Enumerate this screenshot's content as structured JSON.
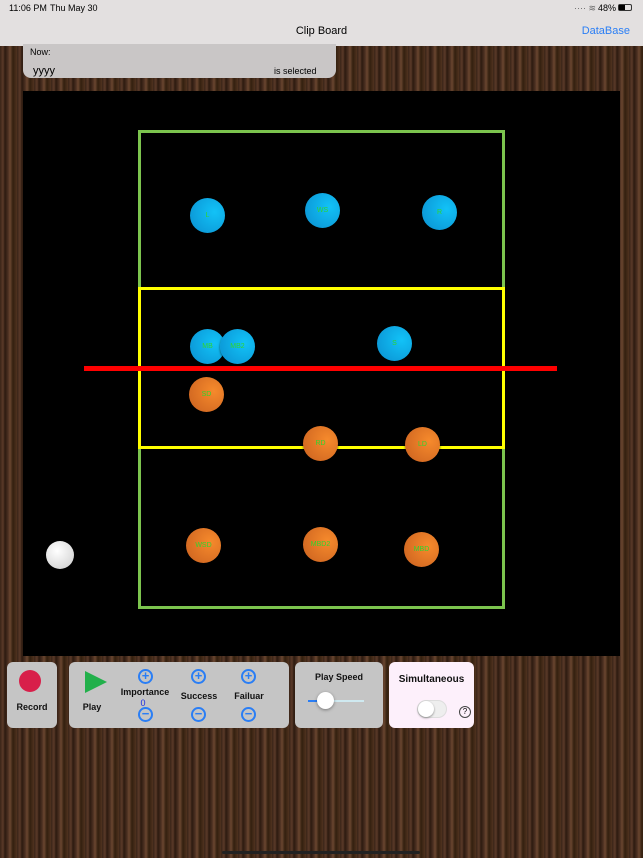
{
  "status_bar": {
    "time": "11:06 PM",
    "date": "Thu May 30",
    "battery": "48%"
  },
  "header": {
    "title": "Clip Board",
    "database_link": "DataBase"
  },
  "now_box": {
    "label": "Now:",
    "value": "yyyy",
    "suffix": "is selected"
  },
  "players": {
    "blue": [
      "L",
      "WS",
      "R",
      "MB",
      "MB2",
      "S"
    ],
    "orange": [
      "SD",
      "RD",
      "LD",
      "WSD",
      "MBD2",
      "MBD"
    ]
  },
  "controls": {
    "record": "Record",
    "play": "Play",
    "importance": "Importance",
    "importance_value": "0",
    "success": "Success",
    "failure": "Failuar",
    "play_speed": "Play Speed",
    "play_speed_value": 0.3,
    "simultaneous": "Simultaneous",
    "simultaneous_on": false,
    "help": "?"
  },
  "colors": {
    "court_outer": "#7cc44e",
    "court_inner": "#ffff00",
    "net": "#ff0000",
    "record": "#d81f4a",
    "play": "#22b04b"
  }
}
